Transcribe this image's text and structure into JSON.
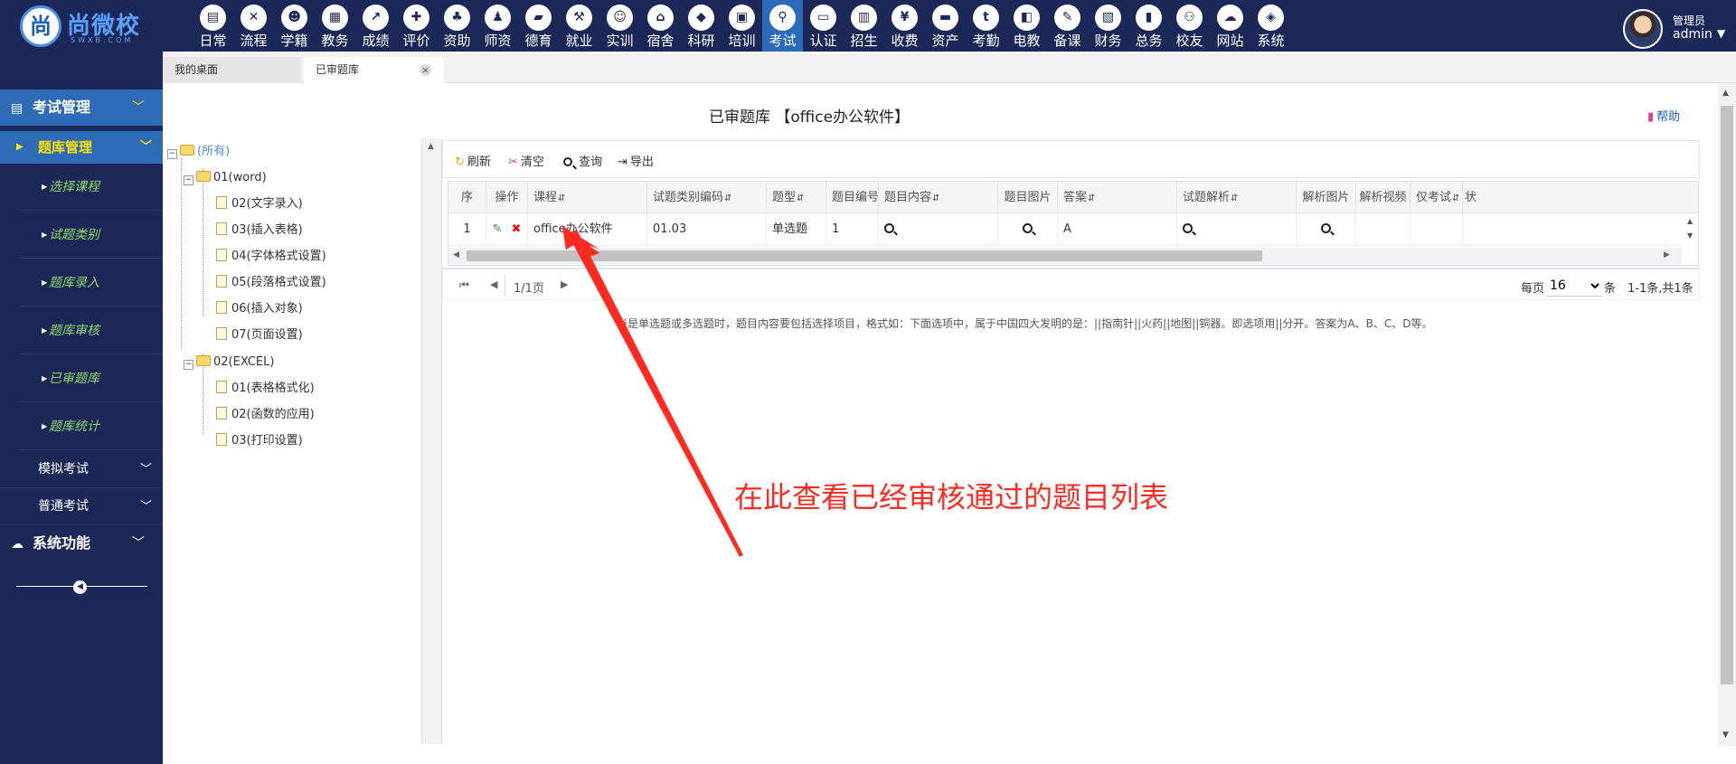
{
  "app": {
    "logo_mark": "尚",
    "logo_name": "尚微校",
    "logo_sub": "SWXB.COM"
  },
  "modules": [
    {
      "label": "日常",
      "icon": "calendar-book-icon"
    },
    {
      "label": "流程",
      "icon": "workflow-icon"
    },
    {
      "label": "学籍",
      "icon": "student-icon"
    },
    {
      "label": "教务",
      "icon": "schedule-icon"
    },
    {
      "label": "成绩",
      "icon": "chart-icon"
    },
    {
      "label": "评价",
      "icon": "evaluate-icon"
    },
    {
      "label": "资助",
      "icon": "aid-icon"
    },
    {
      "label": "师资",
      "icon": "teacher-icon"
    },
    {
      "label": "德育",
      "icon": "moral-book-icon"
    },
    {
      "label": "就业",
      "icon": "hammer-icon"
    },
    {
      "label": "实训",
      "icon": "training-icon"
    },
    {
      "label": "宿舍",
      "icon": "home-icon"
    },
    {
      "label": "科研",
      "icon": "graduation-cap-icon"
    },
    {
      "label": "培训",
      "icon": "picture-icon"
    },
    {
      "label": "考试",
      "icon": "wrench-icon"
    },
    {
      "label": "认证",
      "icon": "monitor-icon"
    },
    {
      "label": "招生",
      "icon": "bus-icon"
    },
    {
      "label": "收费",
      "icon": "yen-icon"
    },
    {
      "label": "资产",
      "icon": "train-icon"
    },
    {
      "label": "考勤",
      "icon": "attendance-t-icon"
    },
    {
      "label": "电教",
      "icon": "media-icon"
    },
    {
      "label": "备课",
      "icon": "edit-icon"
    },
    {
      "label": "财务",
      "icon": "newspaper-icon"
    },
    {
      "label": "总务",
      "icon": "bar-chart-icon"
    },
    {
      "label": "校友",
      "icon": "group-icon"
    },
    {
      "label": "网站",
      "icon": "cloud-icon"
    },
    {
      "label": "系统",
      "icon": "cube-icon"
    }
  ],
  "modules_active": "考试",
  "user": {
    "role": "管理员",
    "name": "admin"
  },
  "tabs": {
    "desktop": "我的桌面",
    "current": "已审题库",
    "close": "×"
  },
  "sidebar": {
    "exam_group": "考试管理",
    "bank_group": "题库管理",
    "bank_items": [
      "选择课程",
      "试题类别",
      "题库录入",
      "题库审核",
      "已审题库",
      "题库统计"
    ],
    "mock": "模拟考试",
    "normal": "普通考试",
    "system": "系统功能"
  },
  "page": {
    "title": "已审题库 【office办公软件】",
    "help": "帮助"
  },
  "tree": {
    "root": "(所有)",
    "word": "01(word)",
    "word_children": [
      "02(文字录入)",
      "03(插入表格)",
      "04(字体格式设置)",
      "05(段落格式设置)",
      "06(插入对象)",
      "07(页面设置)"
    ],
    "excel": "02(EXCEL)",
    "excel_children": [
      "01(表格格式化)",
      "02(函数的应用)",
      "03(打印设置)"
    ]
  },
  "toolbar": {
    "refresh": "刷新",
    "clear": "清空",
    "query": "查询",
    "export": "导出"
  },
  "grid": {
    "headers": {
      "seq": "序",
      "op": "操作",
      "course": "课程",
      "code": "试题类别编码",
      "type": "题型",
      "num": "题目编号",
      "content": "题目内容",
      "img": "题目图片",
      "answer": "答案",
      "analysis": "试题解析",
      "an_img": "解析图片",
      "an_video": "解析视频",
      "only": "仅考试",
      "status": "状"
    },
    "row": {
      "seq": "1",
      "course": "office办公软件",
      "code": "01.03",
      "type": "单选题",
      "num": "1",
      "answer": "A"
    }
  },
  "pager": {
    "page": "1/1页",
    "size_label": "每页",
    "size": "16",
    "size_unit": "条",
    "total": "1-1条,共1条"
  },
  "note": "当是单选题或多选题时，题目内容要包括选择项目，格式如：下面选项中，属于中国四大发明的是：||指南针||火药||地图||铜器。即选项用||分开。答案为A、B、C、D等。",
  "annotation": "在此查看已经审核通过的题目列表",
  "colors": {
    "nav": "#1c2858",
    "active": "#2f6cb8",
    "highlight": "#ffe100",
    "leaf": "#8fd66a",
    "annotation": "#ff2a20"
  }
}
